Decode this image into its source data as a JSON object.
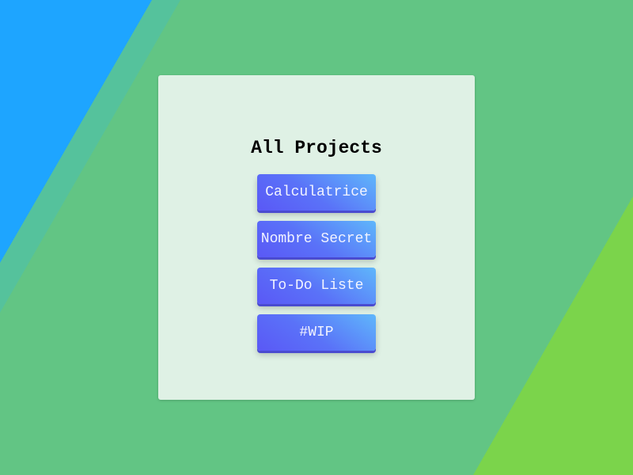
{
  "page": {
    "title": "All Projects"
  },
  "projects": [
    {
      "label": "Calculatrice"
    },
    {
      "label": "Nombre Secret"
    },
    {
      "label": "To-Do Liste"
    },
    {
      "label": "#WIP"
    }
  ],
  "colors": {
    "background": "#62c584",
    "blue_shape": "#1ea5ff",
    "teal_band": "#55c29c",
    "lime_shape": "#7bd44b",
    "panel": "#dff1e5",
    "button_start": "#5a58f6",
    "button_end": "#5fb7fb",
    "button_text": "#f2f4ff"
  }
}
